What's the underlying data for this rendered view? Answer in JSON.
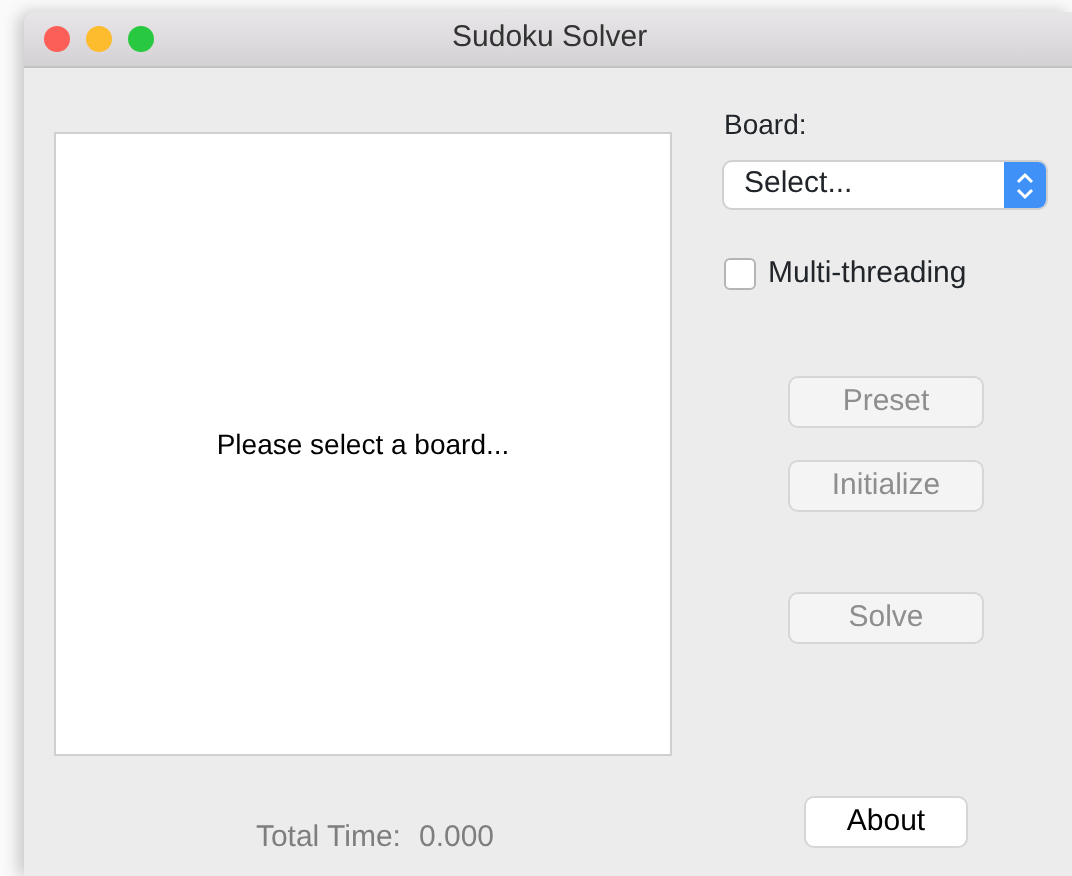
{
  "window": {
    "title": "Sudoku Solver"
  },
  "board_view": {
    "message": "Please select a board..."
  },
  "total_time": {
    "label": "Total Time:",
    "value": "0.000"
  },
  "board": {
    "label": "Board:",
    "value": "Select..."
  },
  "multithreading": {
    "label": "Multi-threading",
    "checked": false
  },
  "buttons": [
    {
      "label": "Preset",
      "disabled": true
    },
    {
      "label": "Initialize",
      "disabled": true
    },
    {
      "label": "Solve",
      "disabled": true
    },
    {
      "label": "About",
      "disabled": false
    }
  ]
}
